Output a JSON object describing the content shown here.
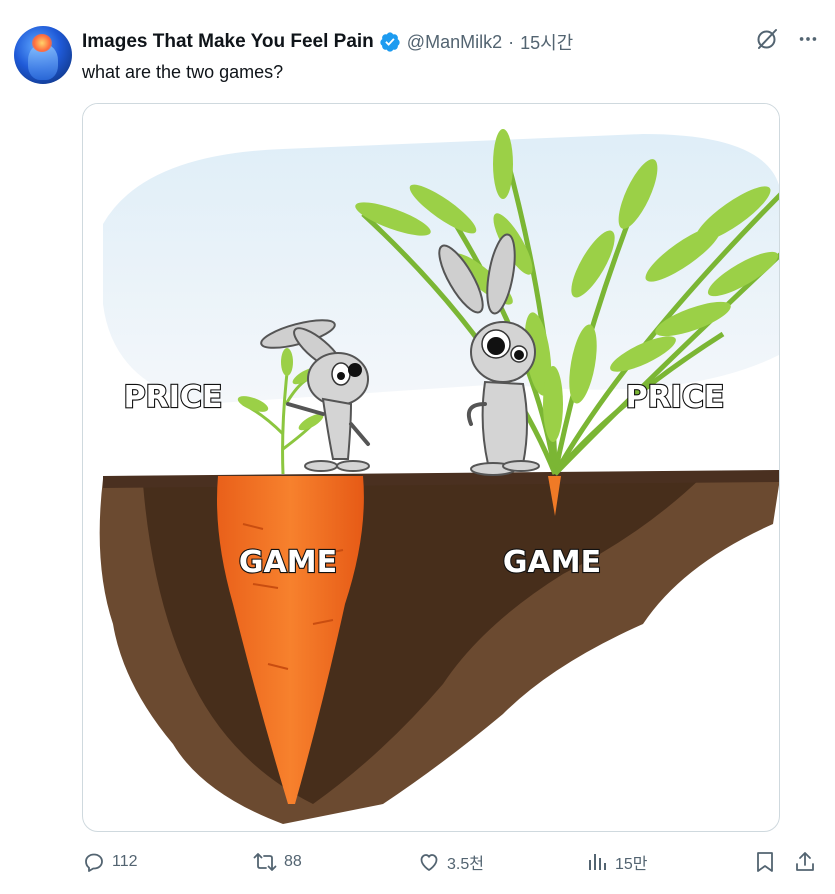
{
  "post": {
    "author_name": "Images That Make You Feel Pain",
    "author_handle": "@ManMilk2",
    "separator": "·",
    "timestamp": "15시간",
    "text": "what are the two games?",
    "verified": true,
    "avatar_icon": "avatar-icon"
  },
  "media": {
    "left_top_label": "PRICE",
    "left_bottom_label": "GAME",
    "right_top_label": "PRICE",
    "right_bottom_label": "GAME"
  },
  "actions": {
    "replies": "112",
    "reposts": "88",
    "likes": "3.5천",
    "views": "15만"
  },
  "icons": {
    "verified": "verified-badge-icon",
    "grok": "grok-icon",
    "more": "more-icon",
    "reply": "reply-icon",
    "repost": "repost-icon",
    "like": "heart-icon",
    "views": "views-icon",
    "bookmark": "bookmark-icon",
    "share": "share-icon"
  },
  "colors": {
    "text": "#0f1419",
    "secondary": "#536471",
    "verified": "#1d9bf0",
    "border": "#cfd9de",
    "carrot": "#f26b1d",
    "leaves": "#8cc63f",
    "soil": "#5a3a22"
  }
}
